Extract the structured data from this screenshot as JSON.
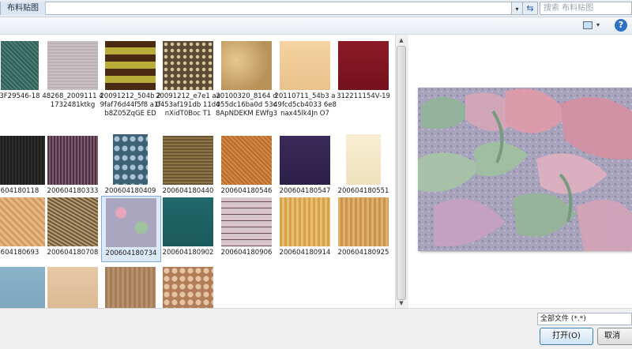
{
  "address": {
    "crumb": "布料贴图",
    "dropdown_icon": "chevron-down-icon",
    "refresh_icon": "refresh-arrows-icon"
  },
  "search": {
    "placeholder": "搜索 布料贴图",
    "icon": "search-icon"
  },
  "toolbar": {
    "view_icon": "view-thumbnail-icon",
    "help_icon": "help-icon",
    "help_glyph": "?"
  },
  "files": [
    {
      "name": "3F29546-18",
      "tex": "teal-weave",
      "selected": false
    },
    {
      "name": "48268_2009111 41732481ktkg",
      "tex": "grey-linen",
      "selected": false
    },
    {
      "name": "20091212_504b 29faf76d44f5f8 a1fb8Z05ZqGE ED",
      "tex": "yellow-plaid",
      "selected": false
    },
    {
      "name": "20091212_e7e1 aa0453af191db 11d4nXidT0Boc T1",
      "tex": "brown-dots",
      "selected": false
    },
    {
      "name": "20100320_8164 d055dc16ba0d 53c8ApNDEKM EWfg3",
      "tex": "tan-marble",
      "selected": false
    },
    {
      "name": "20110711_54b3 a49fcd5cb4033 6e8nax45lk4Jn O7",
      "tex": "beige-plain",
      "selected": false
    },
    {
      "name": "312211154V-19",
      "tex": "dark-red",
      "selected": false
    },
    {
      "name": "604180118",
      "tex": "black-knit",
      "selected": false
    },
    {
      "name": "200604180333",
      "tex": "purple-stripe",
      "selected": false
    },
    {
      "name": "200604180409",
      "tex": "blue-paisley",
      "selected": false
    },
    {
      "name": "200604180440",
      "tex": "khaki-weave",
      "selected": false
    },
    {
      "name": "200604180546",
      "tex": "orange-grid",
      "selected": false
    },
    {
      "name": "200604180547",
      "tex": "navy-purple",
      "selected": false
    },
    {
      "name": "200604180551",
      "tex": "cream",
      "selected": false
    },
    {
      "name": "604180693",
      "tex": "peach-check",
      "selected": false
    },
    {
      "name": "200604180708",
      "tex": "tweed",
      "selected": false
    },
    {
      "name": "200604180734",
      "tex": "floral",
      "selected": true
    },
    {
      "name": "200604180902",
      "tex": "teal-plain",
      "selected": false
    },
    {
      "name": "200604180906",
      "tex": "pink-plaid",
      "selected": false
    },
    {
      "name": "200604180914",
      "tex": "gold-stripe",
      "selected": false
    },
    {
      "name": "200604180925",
      "tex": "wheat-stripe",
      "selected": false
    },
    {
      "name": "",
      "tex": "light-blue",
      "selected": false
    },
    {
      "name": "",
      "tex": "sand",
      "selected": false
    },
    {
      "name": "",
      "tex": "brown-stripe",
      "selected": false
    },
    {
      "name": "",
      "tex": "paisley-tan",
      "selected": false
    }
  ],
  "scrollbar": {
    "up_glyph": "▲",
    "down_glyph": "▼"
  },
  "preview": {
    "selected_file": "200604180734"
  },
  "bottom": {
    "file_type": "全部文件 (*.*)",
    "open_label": "打开(O)",
    "cancel_label": "取消"
  },
  "glyphs": {
    "dropdown": "▾",
    "refresh": "⇆",
    "view_drop": "▾"
  }
}
